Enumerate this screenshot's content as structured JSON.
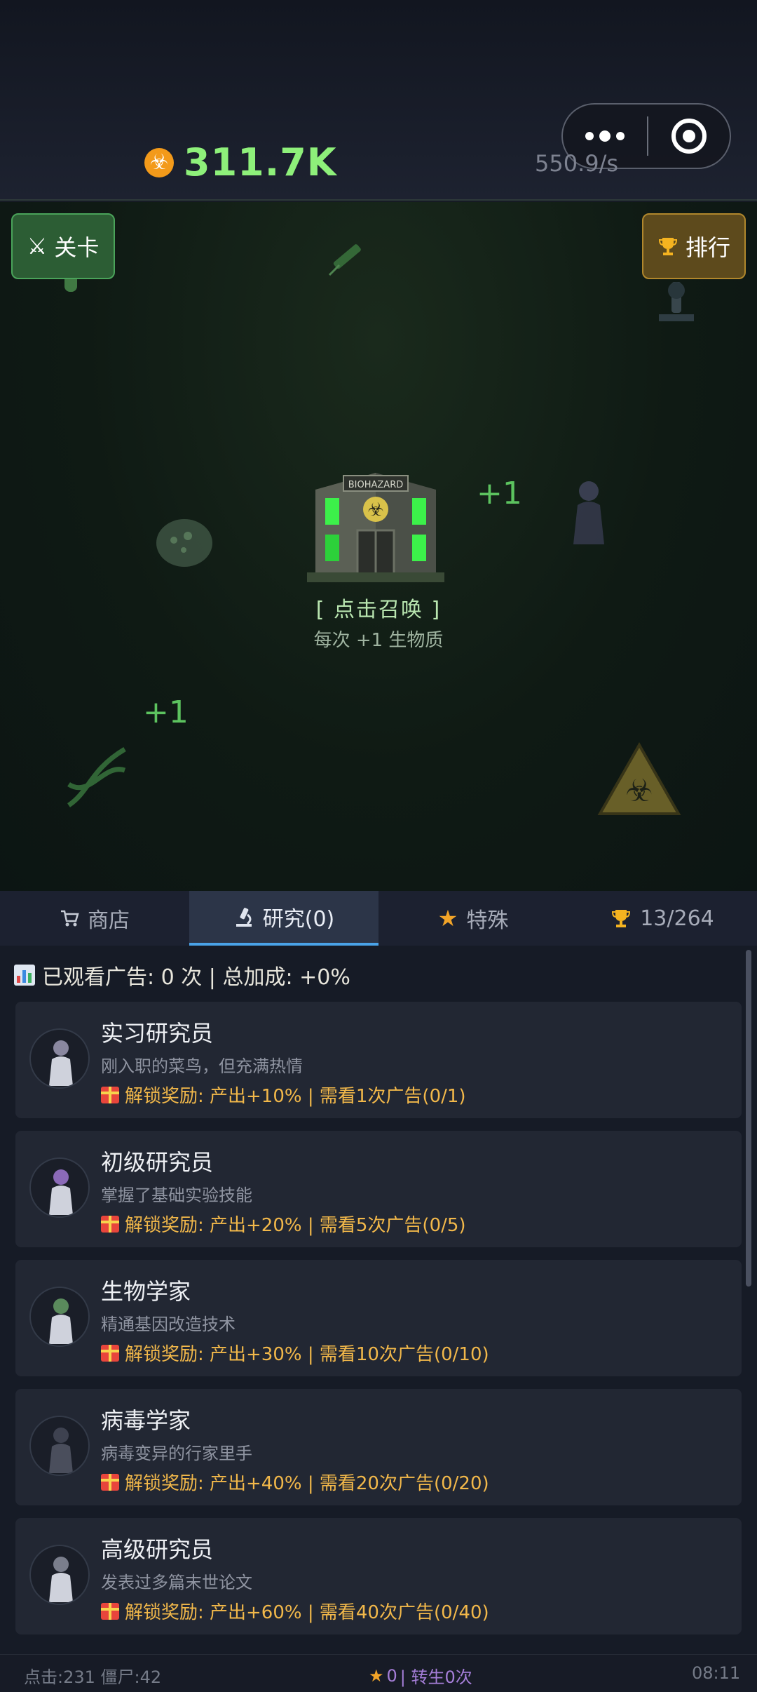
{
  "header": {
    "currency_icon": "biohazard-icon",
    "currency_value": "311.7K",
    "rate": "550.9/s",
    "capsule": {
      "menu_icon": "more-dots-icon",
      "close_icon": "target-icon"
    }
  },
  "game": {
    "levels_label": "关卡",
    "levels_icon": "crossed-swords-icon",
    "rank_label": "排行",
    "rank_icon": "trophy-icon",
    "tap_text": "[ 点击召唤 ]",
    "tap_sub": "每次 +1 生物质",
    "floaters": [
      "+1",
      "+1"
    ],
    "lab_sign": "BIOHAZARD"
  },
  "tabs": [
    {
      "label": "商店",
      "icon": "cart-icon",
      "active": false
    },
    {
      "label": "研究(0)",
      "icon": "microscope-icon",
      "active": true
    },
    {
      "label": "特殊",
      "icon": "star-icon",
      "active": false
    },
    {
      "label": "13/264",
      "icon": "trophy-icon",
      "active": false
    }
  ],
  "panel": {
    "ad_summary": "已观看广告: 0 次 | 总加成: +0%",
    "cards": [
      {
        "title": "实习研究员",
        "desc": "刚入职的菜鸟，但充满热情",
        "reward": "解锁奖励: 产出+10% | 需看1次广告(0/1)"
      },
      {
        "title": "初级研究员",
        "desc": "掌握了基础实验技能",
        "reward": "解锁奖励: 产出+20% | 需看5次广告(0/5)"
      },
      {
        "title": "生物学家",
        "desc": "精通基因改造技术",
        "reward": "解锁奖励: 产出+30% | 需看10次广告(0/10)"
      },
      {
        "title": "病毒学家",
        "desc": "病毒变异的行家里手",
        "reward": "解锁奖励: 产出+40% | 需看20次广告(0/20)"
      },
      {
        "title": "高级研究员",
        "desc": "发表过多篇末世论文",
        "reward": "解锁奖励: 产出+60% | 需看40次广告(0/40)"
      }
    ]
  },
  "footer": {
    "stats": "点击:231 僵尸:42",
    "stars": "0",
    "rebirth": "| 转生0次",
    "time": "08:11"
  },
  "colors": {
    "currency_green": "#8ef07a",
    "reward_gold": "#f2b84a",
    "tab_active_underline": "#4aa3e8",
    "rebirth_purple": "#a57ed8"
  }
}
